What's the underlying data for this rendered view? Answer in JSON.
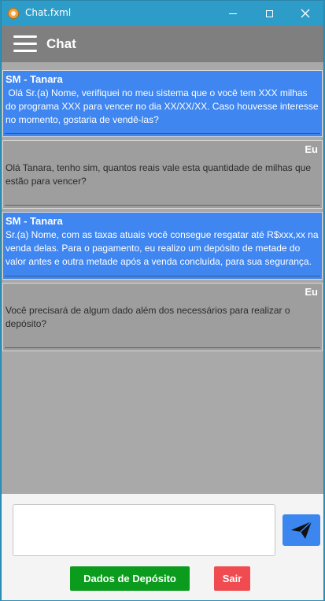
{
  "window": {
    "title": "Chat.fxml"
  },
  "header": {
    "title": "Chat"
  },
  "messages": [
    {
      "sender": "SM - Tanara",
      "text": " Olá Sr.(a) Nome, verifiquei no meu sistema que o você tem XXX milhas do programa XXX para vencer no dia XX/XX/XX. Caso houvesse interesse no momento, gostaria de vendê-las?"
    },
    {
      "sender": "Eu",
      "text": "Olá Tanara, tenho sim, quantos reais vale esta quantidade de milhas que estão para vencer?"
    },
    {
      "sender": "SM - Tanara",
      "text": "Sr.(a) Nome, com as taxas atuais você consegue resgatar até R$xxx,xx na venda delas. Para o pagamento, eu realizo um depósito de metade do valor antes e outra metade após a venda concluída, para sua segurança."
    },
    {
      "sender": "Eu",
      "text": "Você precisará de algum dado além dos necessários para realizar o depósito?"
    }
  ],
  "composer": {
    "value": "",
    "placeholder": ""
  },
  "buttons": {
    "deposit": "Dados de Depósito",
    "exit": "Sair"
  },
  "colors": {
    "theirs": "#3f86f0",
    "mine": "#9e9e9e",
    "send": "#3b86ef",
    "deposit": "#0b9b1d",
    "exit": "#f04b50"
  },
  "icons": {
    "app": "app-logo-icon",
    "menu": "hamburger-menu-icon",
    "send": "paper-plane-icon"
  }
}
